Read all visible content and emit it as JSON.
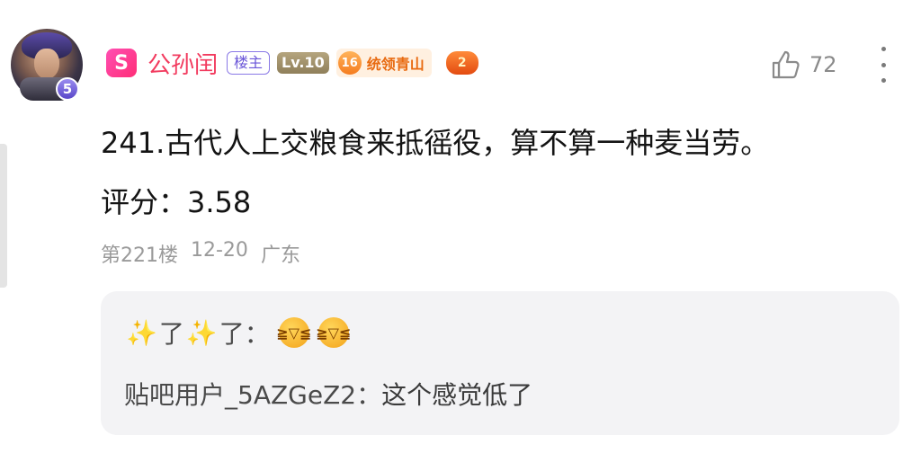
{
  "author": {
    "name": "公孙闰",
    "vip_icon_glyph": "S",
    "avatar_level": "5",
    "tags": {
      "owner": "楼主",
      "level": "Lv.10",
      "title_level": "16",
      "title_text": "统领青山",
      "game_badge": "2"
    }
  },
  "like": {
    "count": "72",
    "icon": "thumbs-up-icon"
  },
  "post": {
    "text": "241.古代人上交粮食来抵徭役，算不算一种麦当劳。",
    "score": "评分：3.58"
  },
  "meta": {
    "floor": "第221楼",
    "date": "12-20",
    "location": "广东"
  },
  "replies": [
    {
      "name_prefix": "✨",
      "name_a": "了",
      "name_b": "了",
      "sep": "：",
      "emoji_icon": "grinning-squint-face-icon"
    },
    {
      "name": "贴吧用户_5AZGeZ2",
      "sep": "：",
      "content": "这个感觉低了"
    }
  ],
  "colors": {
    "username": "#f23a5e",
    "owner_tag": "#6a56d8",
    "title_tag": "#e86a10",
    "reply_bg": "#f3f3f5",
    "meta": "#9a9a9a"
  }
}
